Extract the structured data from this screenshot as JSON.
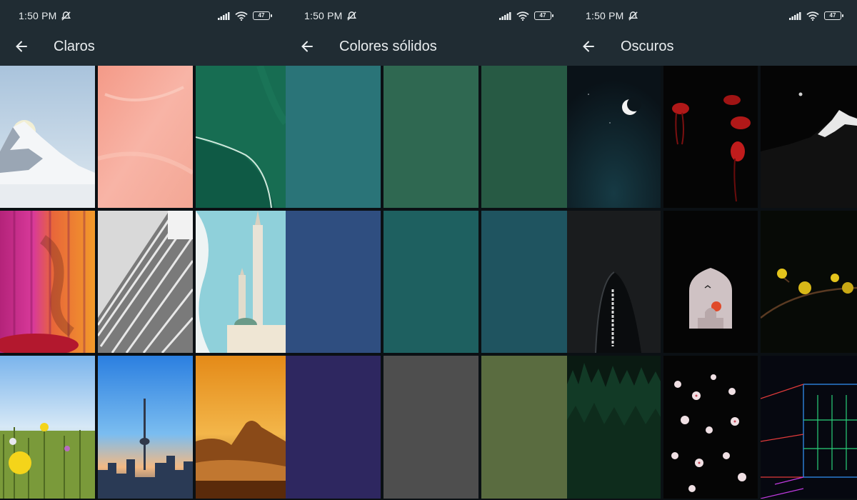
{
  "status": {
    "time": "1:50 PM",
    "battery": "47"
  },
  "screens": [
    {
      "title": "Claros",
      "back_icon": "arrow-left-icon",
      "tiles": [
        "mountain-snow",
        "pink-texture",
        "green-water",
        "silk-curtains",
        "stone-pyramid",
        "white-minaret",
        "yellow-flowers",
        "tv-tower-city",
        "orange-sunset-bay"
      ]
    },
    {
      "title": "Colores sólidos",
      "back_icon": "arrow-left-icon",
      "colors": [
        "#2a7478",
        "#2f6851",
        "#275a44",
        "#2f4e80",
        "#1e6060",
        "#1f5460",
        "#2e2760",
        "#4e4e4e",
        "#5a6c40"
      ]
    },
    {
      "title": "Oscuros",
      "back_icon": "arrow-left-icon",
      "tiles": [
        "crescent-moon-sky",
        "red-jellyfish",
        "dark-mountain-peak",
        "dark-skyscraper",
        "taj-mahal-arch",
        "yellow-blossom-branch",
        "dark-forest",
        "cherry-blossoms-dark",
        "neon-grid-room"
      ]
    }
  ]
}
